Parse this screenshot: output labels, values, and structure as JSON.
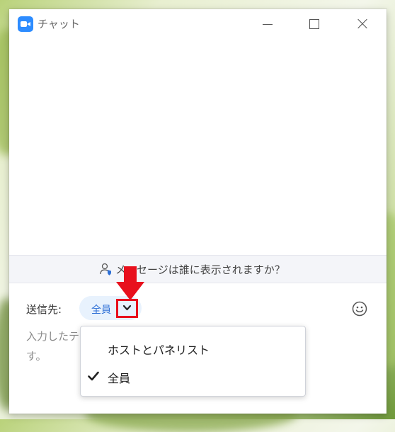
{
  "window": {
    "title": "チャット"
  },
  "visibility_bar": {
    "text": "メッセージは誰に表示されますか？"
  },
  "send_to": {
    "label": "送信先:",
    "selected": "全員"
  },
  "input": {
    "placeholder_line1": "入力したテキストは、全員のユーザーが閲覧できま",
    "placeholder_line2": "す。"
  },
  "dropdown": {
    "options": [
      {
        "label": "ホストとパネリスト",
        "checked": false
      },
      {
        "label": "全員",
        "checked": true
      }
    ]
  },
  "colors": {
    "accent": "#2d8cff",
    "annotation": "#e8101d",
    "pill_bg": "#e8f2fd"
  },
  "icons": [
    "zoom-camera-icon",
    "minimize-icon",
    "maximize-icon",
    "close-icon",
    "person-shield-icon",
    "chevron-down-icon",
    "emoji-icon",
    "checkmark-icon",
    "down-arrow-annotation"
  ]
}
